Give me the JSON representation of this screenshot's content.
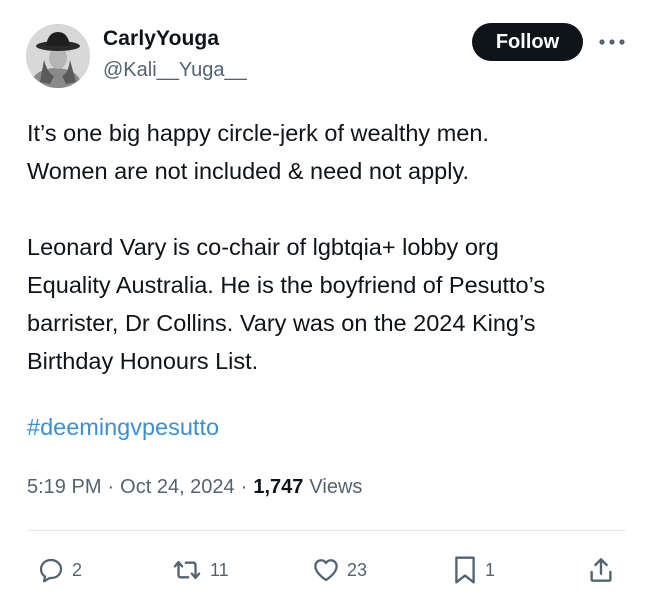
{
  "author": {
    "display_name": "CarlyYouga",
    "handle": "@Kali__Yuga__",
    "follow_label": "Follow"
  },
  "tweet": {
    "paragraph1": "It’s one big happy circle-jerk of wealthy men.\nWomen are not included & need not apply.",
    "paragraph2": "Leonard Vary is co-chair of lgbtqia+ lobby org\nEquality Australia. He is the boyfriend of Pesutto’s\nbarrister, Dr Collins. Vary was on the 2024 King’s\nBirthday Honours List.",
    "hashtag": "#deemingvpesutto"
  },
  "meta": {
    "time": "5:19 PM",
    "date": "Oct 24, 2024",
    "separator": "·",
    "views_count": "1,747",
    "views_label": "Views"
  },
  "actions": {
    "replies": "2",
    "reposts": "11",
    "likes": "23",
    "bookmarks": "1"
  },
  "icons": [
    "avatar",
    "more-icon",
    "reply-icon",
    "repost-icon",
    "like-icon",
    "bookmark-icon",
    "share-icon"
  ],
  "colors": {
    "text": "#0f1419",
    "secondary": "#536471",
    "link": "#3b8fd6",
    "follow_bg": "#0f1419"
  }
}
